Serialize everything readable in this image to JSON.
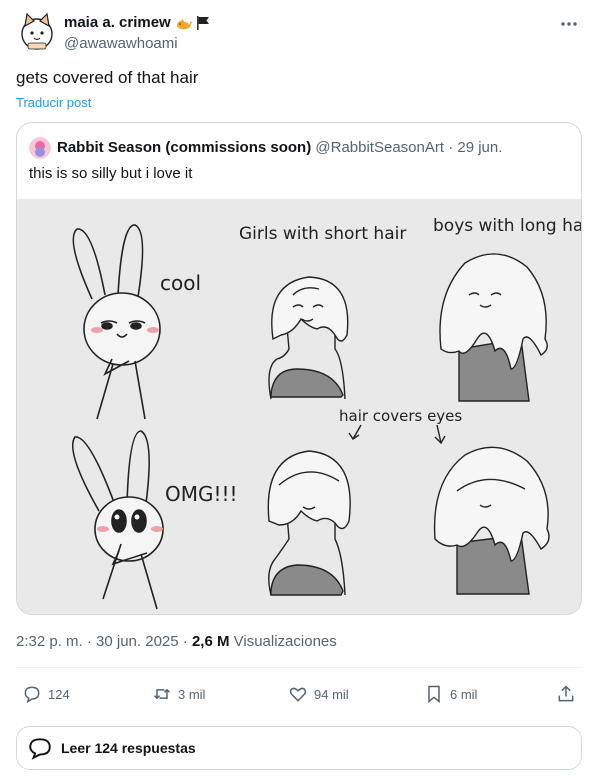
{
  "author": {
    "display_name": "maia a. crimew",
    "name_emojis": [
      "cat-emoji",
      "black-flag-emoji"
    ],
    "handle": "@awawawhoami"
  },
  "tweet": {
    "text": "gets covered of that hair",
    "translate_label": "Traducir post"
  },
  "quoted_post": {
    "display_name": "Rabbit Season (commissions soon)",
    "handle": "@RabbitSeasonArt",
    "separator": "·",
    "date": "29 jun.",
    "text": "this is so silly but i love it",
    "image": {
      "labels": {
        "cool": "cool",
        "omg": "OMG!!!",
        "girls": "Girls with short hair",
        "boys": "boys with long hair",
        "covers": "hair covers eyes"
      }
    }
  },
  "meta": {
    "timestamp": "2:32 p. m. · 30 jun. 2025",
    "separator": "·",
    "views_count": "2,6 M",
    "views_label": "Visualizaciones"
  },
  "actions": {
    "reply": {
      "icon": "reply-icon",
      "count": "124"
    },
    "repost": {
      "icon": "repost-icon",
      "count": "3 mil"
    },
    "like": {
      "icon": "heart-icon",
      "count": "94 mil"
    },
    "bookmark": {
      "icon": "bookmark-icon",
      "count": "6 mil"
    },
    "share": {
      "icon": "share-icon"
    }
  },
  "read_replies": {
    "icon": "speech-bubble-icon",
    "label": "Leer 124 respuestas"
  },
  "colors": {
    "text": "#0f1419",
    "secondary": "#536471",
    "link": "#1d9bf0",
    "border": "#cfd9de"
  }
}
